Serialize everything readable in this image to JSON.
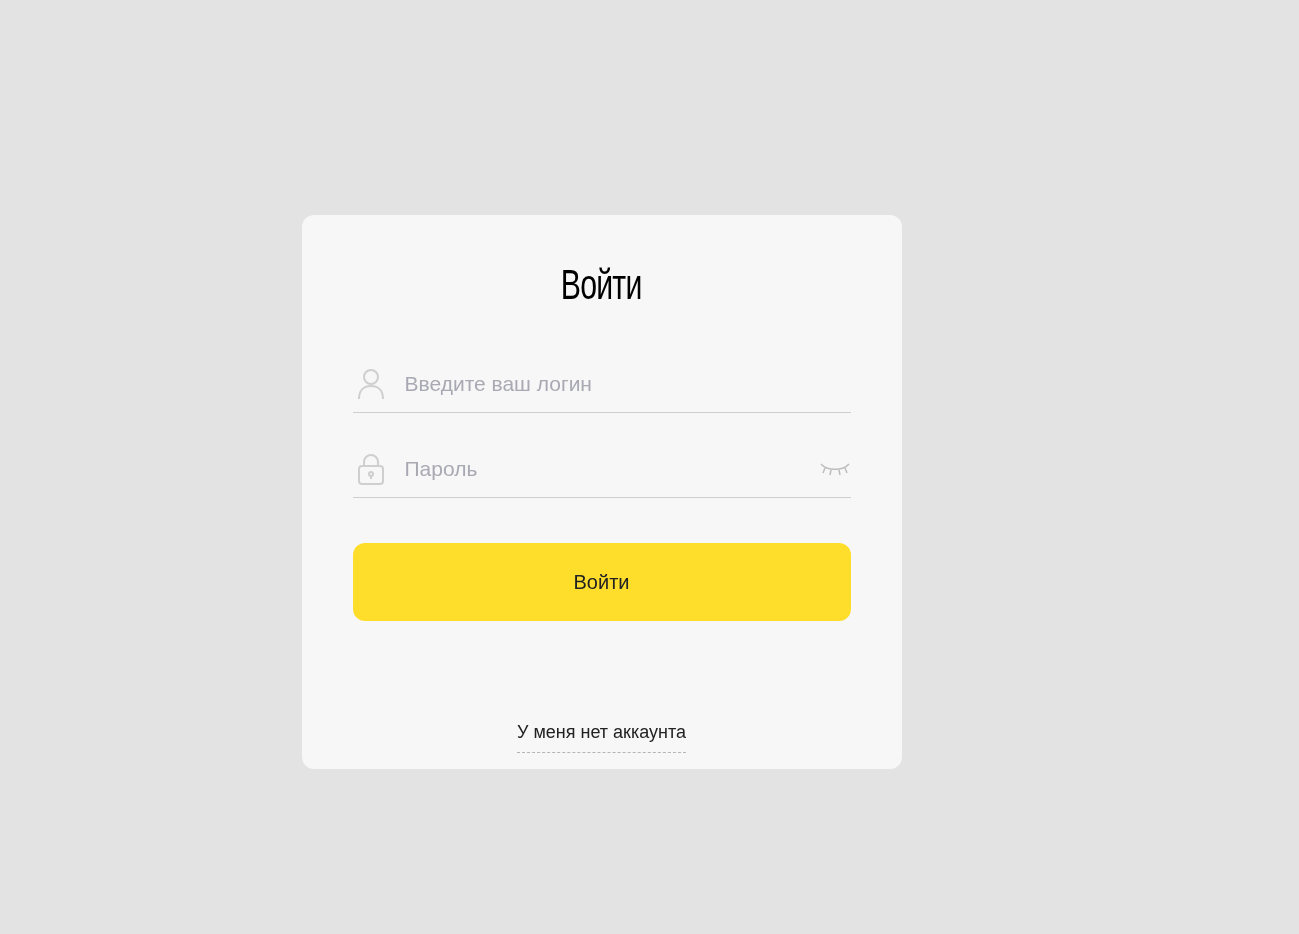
{
  "title": "Войти",
  "login_field": {
    "placeholder": "Введите ваш логин"
  },
  "password_field": {
    "placeholder": "Пароль"
  },
  "submit_button": {
    "label": "Войти"
  },
  "no_account_link": {
    "label": "У меня нет аккаунта"
  }
}
